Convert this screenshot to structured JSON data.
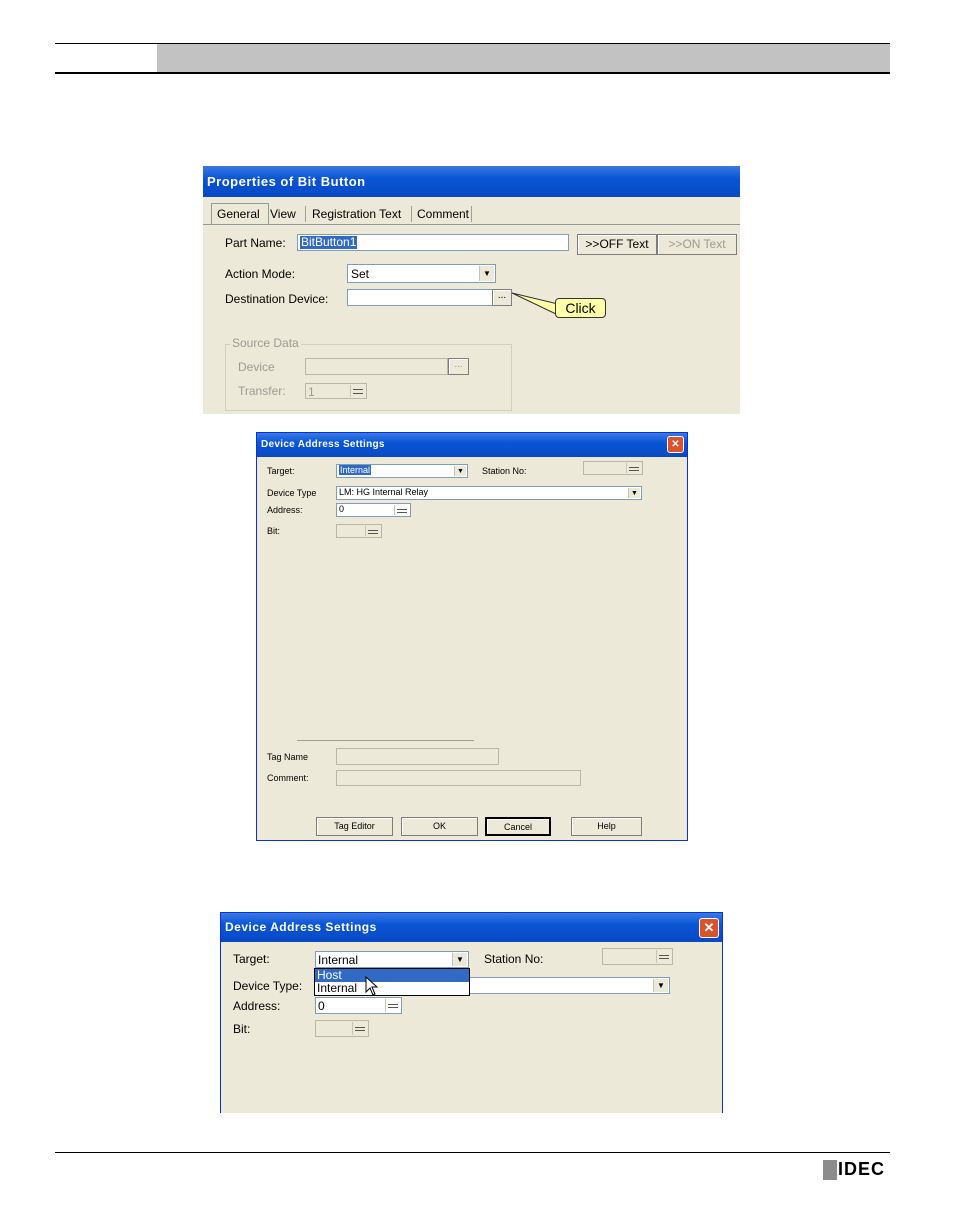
{
  "footer": {
    "logo_text": "IDEC"
  },
  "props_dialog": {
    "title": "Properties of Bit Button",
    "tabs": [
      "General",
      "View",
      "Registration Text",
      "Comment"
    ],
    "part_name_label": "Part Name:",
    "part_name_value": "BitButton1",
    "off_text_button": ">>OFF Text",
    "on_text_button": ">>ON Text",
    "action_mode_label": "Action Mode:",
    "action_mode_value": "Set",
    "dest_device_label": "Destination Device:",
    "dest_device_value": "",
    "browse_button": "...",
    "callout_label": "Click",
    "source_group_label": "Source Data",
    "device_label": "Device",
    "transfer_label": "Transfer:",
    "transfer_value": "1"
  },
  "das_dialog_1": {
    "title": "Device Address Settings",
    "close_glyph": "✕",
    "target_label": "Target:",
    "target_value": "Internal",
    "station_label": "Station No:",
    "device_type_label": "Device Type",
    "device_type_value": "LM: HG Internal Relay",
    "address_label": "Address:",
    "address_value": "0",
    "bit_label": "Bit:",
    "tag_name_label": "Tag Name",
    "comment_label": "Comment:",
    "buttons": {
      "tag_editor": "Tag Editor",
      "ok": "OK",
      "cancel": "Cancel",
      "help": "Help"
    }
  },
  "das_dialog_2": {
    "title": "Device Address Settings",
    "close_glyph": "✕",
    "target_label": "Target:",
    "target_value": "Internal",
    "station_label": "Station No:",
    "device_type_label": "Device Type:",
    "address_label": "Address:",
    "address_value": "0",
    "bit_label": "Bit:",
    "dropdown_options": [
      "Host",
      "Internal"
    ],
    "dropdown_highlighted": "Host"
  }
}
